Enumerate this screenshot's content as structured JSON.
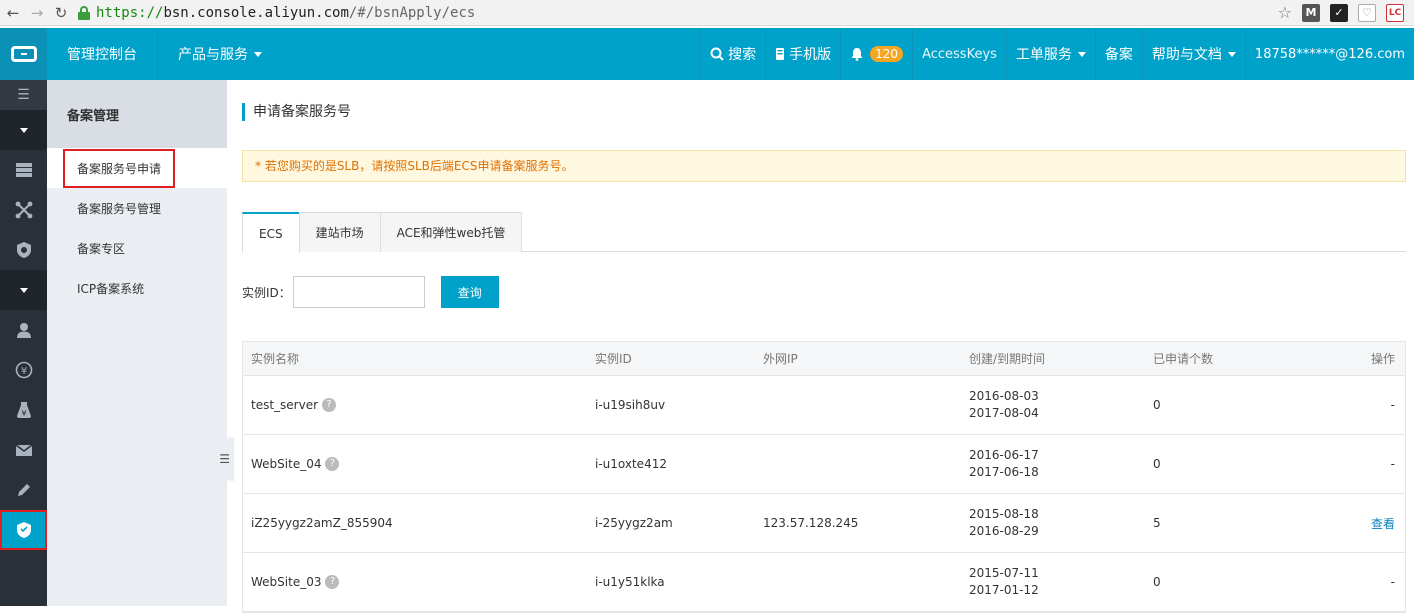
{
  "browser": {
    "url_scheme": "https://",
    "url_host": "bsn.console.aliyun.com",
    "url_path": "/#/bsnApply/ecs"
  },
  "topnav": {
    "console": "管理控制台",
    "products": "产品与服务",
    "search": "搜索",
    "mobile": "手机版",
    "notification_count": "120",
    "accesskeys": "AccessKeys",
    "tickets": "工单服务",
    "beian": "备案",
    "help": "帮助与文档",
    "user": "18758******@126.com"
  },
  "subnav": {
    "title": "备案管理",
    "items": [
      {
        "label": "备案服务号申请"
      },
      {
        "label": "备案服务号管理"
      },
      {
        "label": "备案专区"
      },
      {
        "label": "ICP备案系统"
      }
    ]
  },
  "main": {
    "title": "申请备案服务号",
    "notice": "* 若您购买的是SLB，请按照SLB后端ECS申请备案服务号。",
    "tabs": [
      {
        "label": "ECS"
      },
      {
        "label": "建站市场"
      },
      {
        "label": "ACE和弹性web托管"
      }
    ],
    "search_label": "实例ID：",
    "search_value": "",
    "search_button": "查询",
    "columns": [
      "实例名称",
      "实例ID",
      "外网IP",
      "创建/到期时间",
      "已申请个数",
      "操作"
    ],
    "rows": [
      {
        "name": "test_server",
        "id": "i-u19sih8uv",
        "ip": "",
        "created": "2016-08-03",
        "expires": "2017-08-04",
        "count": "0",
        "action": "-"
      },
      {
        "name": "WebSite_04",
        "id": "i-u1oxte412",
        "ip": "",
        "created": "2016-06-17",
        "expires": "2017-06-18",
        "count": "0",
        "action": "-"
      },
      {
        "name": "iZ25yygz2amZ_855904",
        "id": "i-25yygz2am",
        "ip": "123.57.128.245",
        "created": "2015-08-18",
        "expires": "2016-08-29",
        "count": "5",
        "action": "查看"
      },
      {
        "name": "WebSite_03",
        "id": "i-u1y51klka",
        "ip": "",
        "created": "2015-07-11",
        "expires": "2017-01-12",
        "count": "0",
        "action": "-"
      }
    ]
  },
  "colors": {
    "accent": "#00a2ca",
    "rail": "#293038",
    "highlight": "#e02020"
  }
}
